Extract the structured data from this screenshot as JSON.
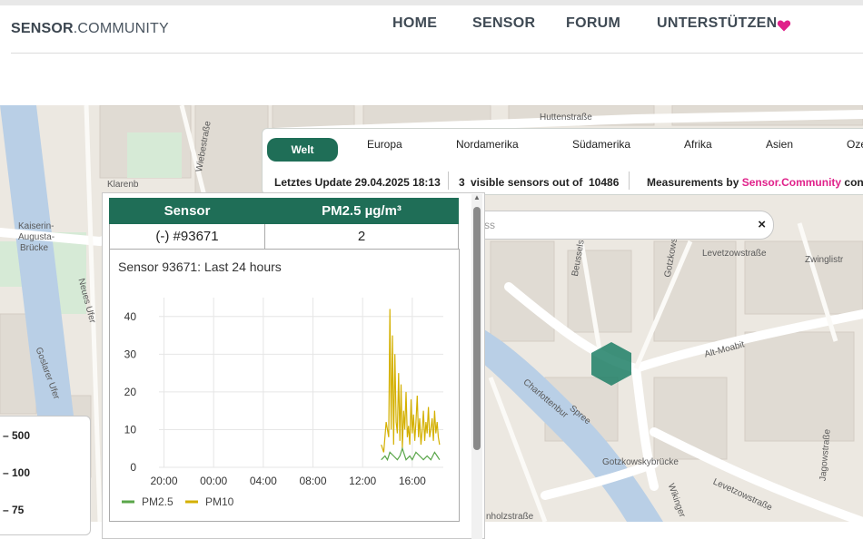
{
  "brand": {
    "bold": "SENSOR",
    "rest": ".COMMUNITY"
  },
  "nav": [
    {
      "label": "HOME"
    },
    {
      "label": "SENSOR"
    },
    {
      "label": "FORUM"
    },
    {
      "label": "UNTERSTÜTZEN",
      "icon": "heart-icon",
      "icon_color": "#e0218a"
    }
  ],
  "regions": [
    "Welt",
    "Europa",
    "Nordamerika",
    "Südamerika",
    "Afrika",
    "Asien",
    "Oze"
  ],
  "active_region": "Welt",
  "status": {
    "last_update": "Letztes Update 29.04.2025 18:13",
    "visible_count": "3",
    "visible_text": "visible sensors out of",
    "total": "10486",
    "measurements_prefix": "Measurements by ",
    "measurements_brand": "Sensor.Community",
    "measurements_suffix": " contri"
  },
  "search": {
    "placeholder": "ss",
    "clear": "×"
  },
  "map_labels": {
    "huttenstrasse": "Huttenstraße",
    "wiebestrasse": "Wiebestraße",
    "kaiserin": "Kaiserin-",
    "augusta": "Augusta-",
    "bruecke": "Brücke",
    "neues_ufer": "Neues Ufer",
    "goslarer": "Goslarer Ufer",
    "beusselstrasse": "Beusselstr",
    "gotzkowsky": "Gotzkowsk",
    "levetzowstr": "Levetzowstraße",
    "zwinglistrasse": "Zwinglistraße",
    "zwingli2": "Zwinglistr",
    "alt_moabit": "Alt-Moabit",
    "spree": "Spree",
    "charlottenburger": "Charlottenbur",
    "gotzkowskybruecke": "Gotzkowskybrücke",
    "levetzowstrasse": "Levetzowstraße",
    "jagowstrasse": "Jagowstraße",
    "wikingerufer": "Wikinger",
    "holzstrasse": "nholzstraße",
    "gelest": "Klarenb"
  },
  "legend": [
    "– 500",
    "– 100",
    "– 75"
  ],
  "popup": {
    "col_sensor": "Sensor",
    "col_value": "PM2.5 µg/m³",
    "sensor_id": "(-) #93671",
    "value": "2",
    "chart_title": "Sensor 93671: Last 24 hours"
  },
  "chart_data": {
    "type": "line",
    "title": "Sensor 93671: Last 24 hours",
    "x_ticks": [
      "20:00",
      "00:00",
      "04:00",
      "08:00",
      "12:00",
      "16:00"
    ],
    "y_ticks": [
      0,
      10,
      20,
      30,
      40
    ],
    "ylim": [
      0,
      45
    ],
    "grid": true,
    "legend_position": "bottom-left",
    "series": [
      {
        "name": "PM2.5",
        "color": "#5aa64a",
        "x": [
          13.5,
          13.8,
          14.0,
          14.2,
          14.5,
          14.8,
          15.0,
          15.2,
          15.5,
          15.8,
          16.0,
          16.3,
          16.6,
          16.9,
          17.2,
          17.5,
          17.8,
          18.0,
          18.2
        ],
        "values": [
          2,
          3,
          2,
          4,
          3,
          2,
          3,
          5,
          2,
          3,
          2,
          4,
          3,
          2,
          3,
          2,
          4,
          3,
          2
        ]
      },
      {
        "name": "PM10",
        "color": "#d4b000",
        "x": [
          13.5,
          13.7,
          13.9,
          14.1,
          14.2,
          14.3,
          14.4,
          14.5,
          14.6,
          14.7,
          14.8,
          14.9,
          15.0,
          15.1,
          15.2,
          15.3,
          15.4,
          15.5,
          15.6,
          15.7,
          15.8,
          15.9,
          16.0,
          16.1,
          16.2,
          16.3,
          16.4,
          16.5,
          16.6,
          16.7,
          16.8,
          16.9,
          17.0,
          17.1,
          17.2,
          17.3,
          17.4,
          17.5,
          17.6,
          17.7,
          17.8,
          17.9,
          18.0,
          18.1,
          18.2
        ],
        "values": [
          6,
          4,
          12,
          8,
          42,
          10,
          35,
          6,
          30,
          12,
          9,
          25,
          7,
          22,
          5,
          15,
          10,
          20,
          8,
          11,
          6,
          18,
          9,
          14,
          7,
          12,
          19,
          8,
          13,
          6,
          10,
          15,
          7,
          12,
          9,
          16,
          8,
          10,
          13,
          7,
          15,
          9,
          12,
          8,
          6
        ]
      }
    ]
  }
}
